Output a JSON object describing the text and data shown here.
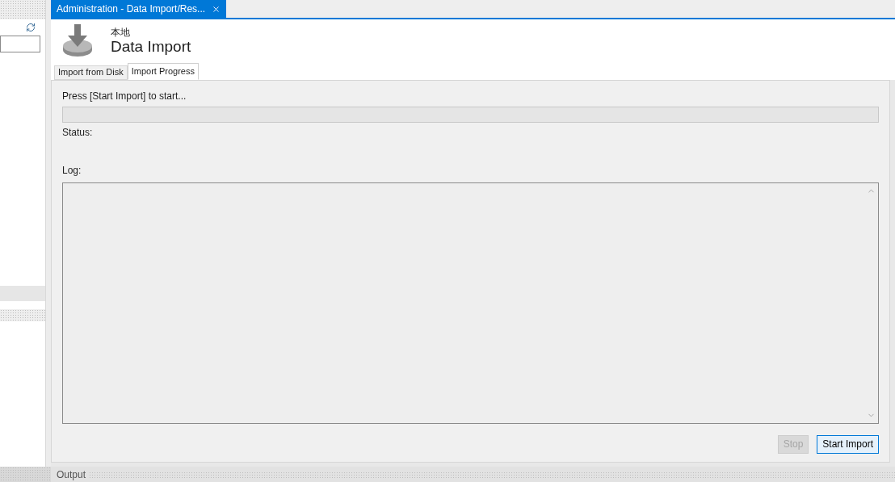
{
  "document_tab": {
    "title": "Administration - Data Import/Res...",
    "selected": true
  },
  "header": {
    "connection": "本地",
    "title": "Data Import"
  },
  "tabs": [
    {
      "label": "Import from Disk",
      "selected": false
    },
    {
      "label": "Import Progress",
      "selected": true
    }
  ],
  "progress": {
    "message": "Press [Start Import] to start...",
    "level": 0
  },
  "status_label": "Status:",
  "log_label": "Log:",
  "buttons": [
    {
      "label": "Stop",
      "disabled": true
    },
    {
      "label": "Start Import",
      "disabled": false
    }
  ],
  "output_panel": {
    "title": "Output"
  }
}
